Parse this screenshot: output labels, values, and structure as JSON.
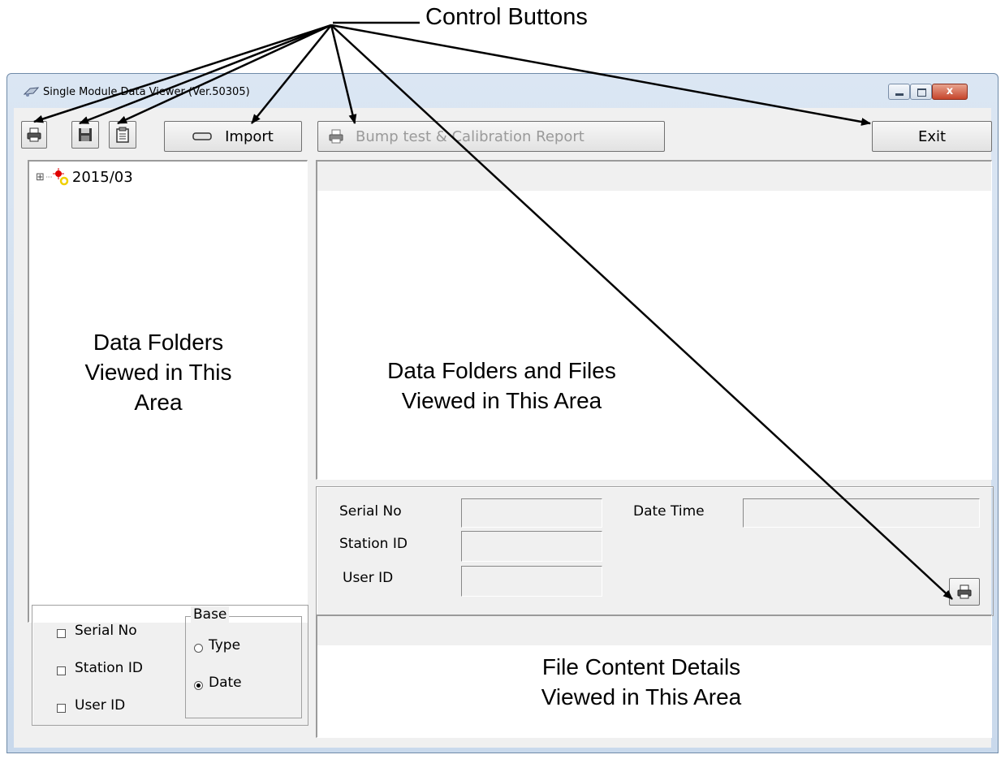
{
  "annotations": {
    "control_buttons": "Control Buttons",
    "folders_area": [
      "Data Folders",
      "Viewed in This",
      "Area"
    ],
    "files_area": [
      "Data Folders and Files",
      "Viewed in This Area"
    ],
    "details_area": [
      "File Content Details",
      "Viewed in This Area"
    ]
  },
  "window": {
    "title": "Single Module Data Viewer (Ver.50305)",
    "close_glyph": "x"
  },
  "toolbar": {
    "print_icon": "printer-icon",
    "save_icon": "floppy-disk-icon",
    "clipboard_icon": "clipboard-icon",
    "import_label": "Import",
    "report_label": "Bump test & Calibration Report",
    "exit_label": "Exit"
  },
  "tree": {
    "expander": "⊞",
    "items": [
      {
        "label": "2015/03"
      }
    ]
  },
  "filters": {
    "serial_no": "Serial No",
    "station_id": "Station ID",
    "user_id": "User ID",
    "base_title": "Base",
    "base_type": "Type",
    "base_date": "Date",
    "selected_base": "Date"
  },
  "details": {
    "serial_no_label": "Serial No",
    "station_id_label": "Station ID",
    "user_id_label": "User ID",
    "date_time_label": "Date Time",
    "serial_no_value": "",
    "station_id_value": "",
    "user_id_value": "",
    "date_time_value": ""
  }
}
